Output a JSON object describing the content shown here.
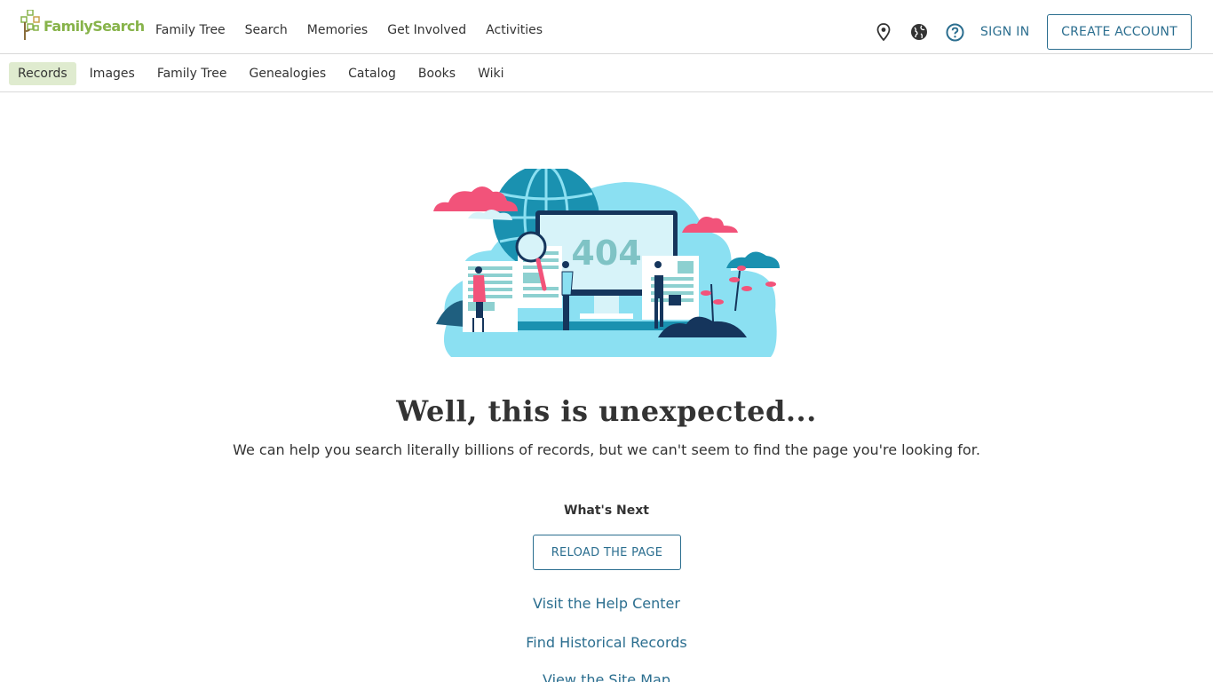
{
  "header": {
    "logo_text": "FamilySearch",
    "nav": [
      "Family Tree",
      "Search",
      "Memories",
      "Get Involved",
      "Activities"
    ],
    "icons": [
      "location-pin-icon",
      "globe-icon",
      "help-icon"
    ],
    "sign_in": "SIGN IN",
    "create_account": "CREATE ACCOUNT"
  },
  "subnav": {
    "items": [
      "Records",
      "Images",
      "Family Tree",
      "Genealogies",
      "Catalog",
      "Books",
      "Wiki"
    ],
    "active": "Records"
  },
  "illustration": {
    "code": "404"
  },
  "error": {
    "title": "Well, this is unexpected...",
    "message": "We can help you search literally billions of records, but we can't seem to find the page you're looking for.",
    "next_title": "What's Next",
    "reload": "RELOAD THE PAGE",
    "links": [
      "Visit the Help Center",
      "Find Historical Records",
      "View the Site Map"
    ]
  },
  "colors": {
    "brand_green": "#87b34a",
    "link_blue": "#2b6e8f",
    "active_tab_bg": "#dfebcf"
  }
}
